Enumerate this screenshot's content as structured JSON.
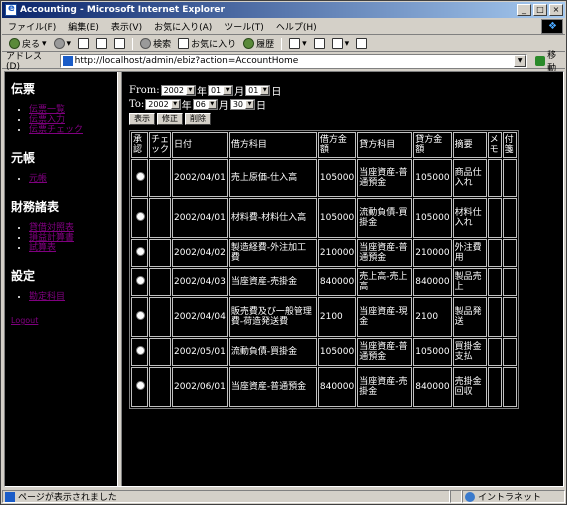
{
  "window": {
    "title": "Accounting - Microsoft Internet Explorer"
  },
  "menu": [
    "ファイル(F)",
    "編集(E)",
    "表示(V)",
    "お気に入り(A)",
    "ツール(T)",
    "ヘルプ(H)"
  ],
  "toolbar": {
    "back": "戻る",
    "search": "検索",
    "favorites": "お気に入り",
    "history": "履歴"
  },
  "address": {
    "label": "アドレス(D)",
    "url": "http://localhost/admin/ebiz?action=AccountHome",
    "go": "移動"
  },
  "sidebar": {
    "sections": [
      {
        "title": "伝票",
        "links": [
          "伝票一覧",
          "伝票入力",
          "伝票チェック"
        ]
      },
      {
        "title": "元帳",
        "links": [
          "元帳"
        ]
      },
      {
        "title": "財務諸表",
        "links": [
          "貸借対照表",
          "損益計算書",
          "試算表"
        ]
      },
      {
        "title": "設定",
        "links": [
          "勘定科目"
        ]
      }
    ],
    "logout": "Logout"
  },
  "filter": {
    "from_label": "From:",
    "to_label": "To:",
    "from": {
      "year": "2002",
      "month": "01",
      "day": "01"
    },
    "to": {
      "year": "2002",
      "month": "06",
      "day": "30"
    },
    "year_unit": "年",
    "month_unit": "月",
    "day_unit": "日",
    "buttons": {
      "show": "表示",
      "edit": "修正",
      "delete": "削除"
    }
  },
  "table": {
    "headers": [
      "承認",
      "チェック",
      "日付",
      "借方科目",
      "借方金額",
      "貸方科目",
      "貸方金額",
      "摘要",
      "メモ",
      "付箋"
    ],
    "rows": [
      {
        "date": "2002/04/01",
        "debit": "売上原価-仕入高",
        "debit_amount": "105000",
        "credit": "当座資産-普通預金",
        "credit_amount": "105000",
        "summary": "商品仕入れ",
        "memo": "",
        "tag": ""
      },
      {
        "date": "2002/04/01",
        "debit": "材料費-材料仕入高",
        "debit_amount": "105000",
        "credit": "流動負債-買掛金",
        "credit_amount": "105000",
        "summary": "材料仕入れ",
        "memo": "",
        "tag": ""
      },
      {
        "date": "2002/04/02",
        "debit": "製造経費-外注加工費",
        "debit_amount": "210000",
        "credit": "当座資産-普通預金",
        "credit_amount": "210000",
        "summary": "外注費用",
        "memo": "",
        "tag": ""
      },
      {
        "date": "2002/04/03",
        "debit": "当座資産-売掛金",
        "debit_amount": "840000",
        "credit": "売上高-売上高",
        "credit_amount": "840000",
        "summary": "製品売上",
        "memo": "",
        "tag": ""
      },
      {
        "date": "2002/04/04",
        "debit": "販売費及び一般管理費-荷造発送費",
        "debit_amount": "2100",
        "credit": "当座資産-現金",
        "credit_amount": "2100",
        "summary": "製品発送",
        "memo": "",
        "tag": ""
      },
      {
        "date": "2002/05/01",
        "debit": "流動負債-買掛金",
        "debit_amount": "105000",
        "credit": "当座資産-普通預金",
        "credit_amount": "105000",
        "summary": "買掛金支払",
        "memo": "",
        "tag": ""
      },
      {
        "date": "2002/06/01",
        "debit": "当座資産-普通預金",
        "debit_amount": "840000",
        "credit": "当座資産-売掛金",
        "credit_amount": "840000",
        "summary": "売掛金回収",
        "memo": "",
        "tag": ""
      }
    ]
  },
  "status": {
    "text": "ページが表示されました",
    "zone": "イントラネット"
  }
}
